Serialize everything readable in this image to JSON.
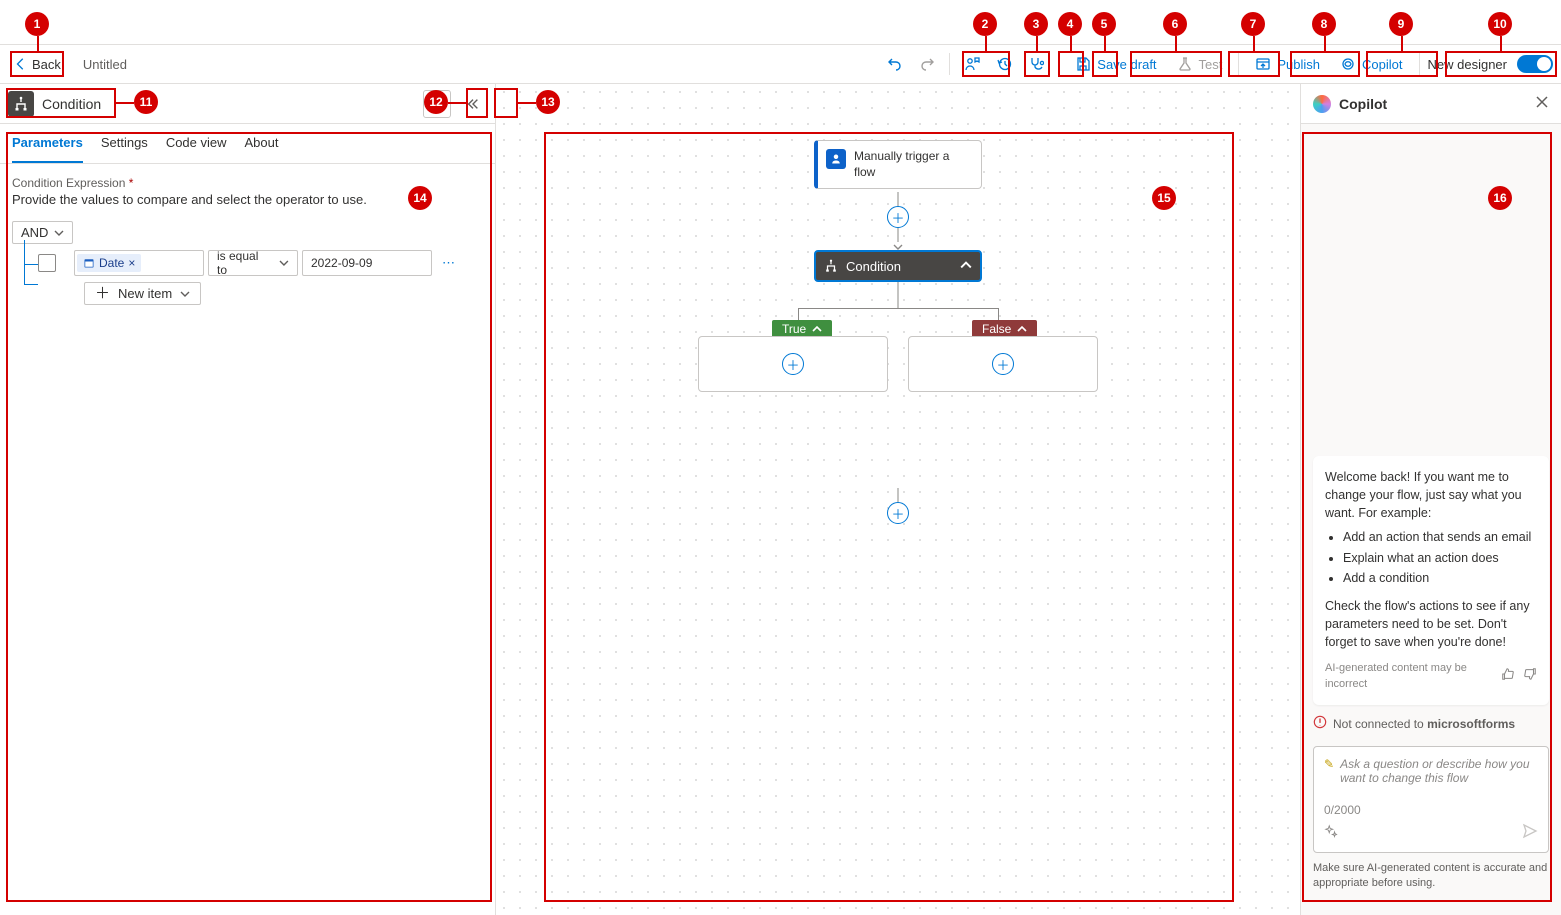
{
  "topbar": {
    "back": "Back",
    "title": "Untitled",
    "save_draft": "Save draft",
    "test": "Test",
    "publish": "Publish",
    "copilot": "Copilot",
    "new_designer": "New designer"
  },
  "panel": {
    "title": "Condition",
    "tabs": {
      "parameters": "Parameters",
      "settings": "Settings",
      "code_view": "Code view",
      "about": "About"
    },
    "expr_label": "Condition Expression",
    "expr_desc": "Provide the values to compare and select the operator to use.",
    "andor": "AND",
    "token": "Date",
    "operator": "is equal to",
    "value": "2022-09-09",
    "new_item": "New item"
  },
  "canvas": {
    "trigger": "Manually trigger a flow",
    "condition": "Condition",
    "true": "True",
    "false": "False"
  },
  "copilot": {
    "title": "Copilot",
    "welcome_intro": "Welcome back! If you want me to change your flow, just say what you want. For example:",
    "suggestions": [
      "Add an action that sends an email",
      "Explain what an action does",
      "Add a condition"
    ],
    "welcome_outro": "Check the flow's actions to see if any parameters need to be set. Don't forget to save when you're done!",
    "ai_disclaimer": "AI-generated content may be incorrect",
    "not_connected_pre": "Not connected to ",
    "not_connected_svc": "microsoftforms",
    "placeholder": "Ask a question or describe how you want to change this flow",
    "counter": "0/2000",
    "bottom_disc": "Make sure AI-generated content is accurate and appropriate before using."
  },
  "annotations": {
    "1": "1",
    "2": "2",
    "3": "3",
    "4": "4",
    "5": "5",
    "6": "6",
    "7": "7",
    "8": "8",
    "9": "9",
    "10": "10",
    "11": "11",
    "12": "12",
    "13": "13",
    "14": "14",
    "15": "15",
    "16": "16"
  }
}
